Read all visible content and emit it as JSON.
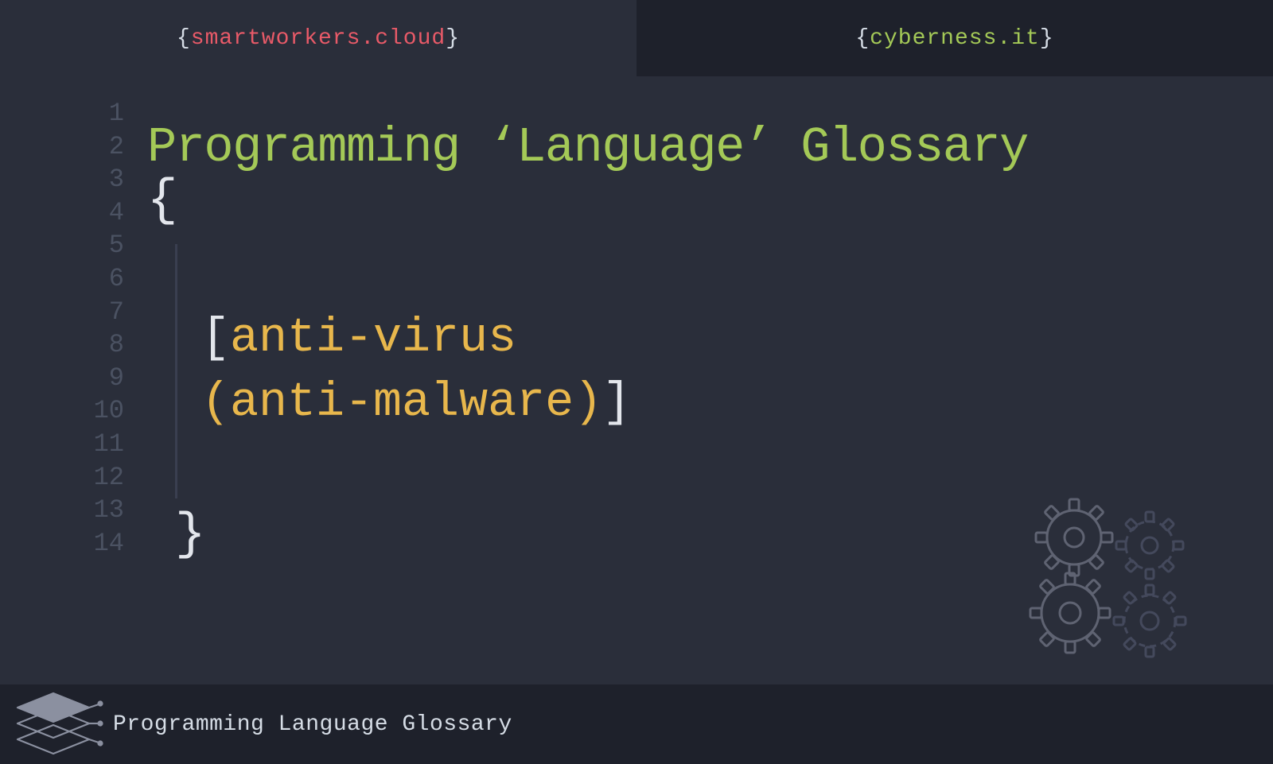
{
  "header": {
    "tabs": [
      {
        "brace_open": "{",
        "domain": "smartworkers.cloud",
        "brace_close": "}"
      },
      {
        "brace_open": "{",
        "domain": "cyberness.it",
        "brace_close": "}"
      }
    ]
  },
  "editor": {
    "line_numbers": [
      "1",
      "2",
      "3",
      "4",
      "5",
      "6",
      "7",
      "8",
      "9",
      "10",
      "11",
      "12",
      "13",
      "14"
    ],
    "title": "Programming ‘Language’ Glossary",
    "open_brace": "{",
    "term": {
      "open_bracket": "[",
      "word1": "anti-virus",
      "line2_open_paren": "(",
      "word2": "anti-malware",
      "line2_close_paren": ")",
      "close_bracket": "]"
    },
    "close_brace": "}"
  },
  "decor": {
    "gears_icon": "gears-icon"
  },
  "footer": {
    "logo": "stacked-layers-icon",
    "label": "Programming Language Glossary"
  },
  "colors": {
    "bg": "#2a2e3a",
    "bg_dark": "#1e212b",
    "gutter": "#4b5262",
    "green": "#a4c957",
    "red": "#e85a68",
    "yellow": "#e8b74c",
    "white": "#e3e6ec"
  }
}
